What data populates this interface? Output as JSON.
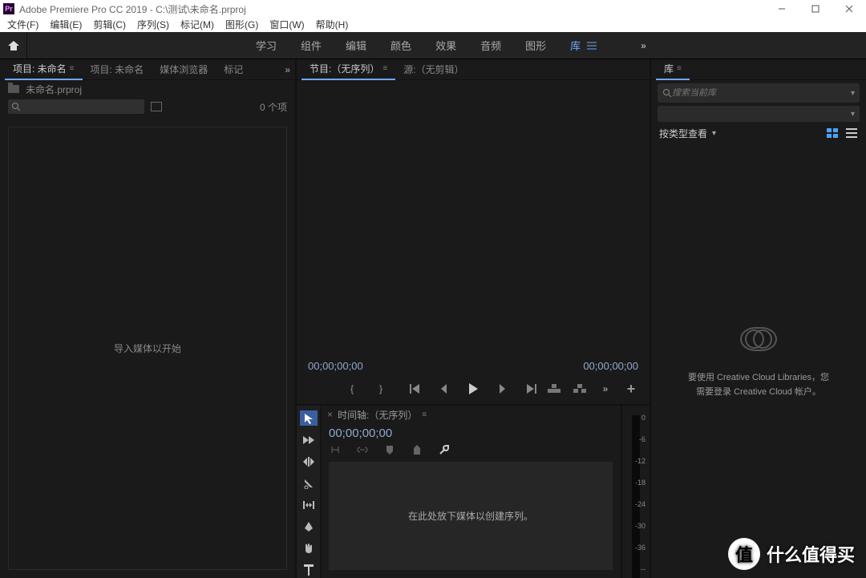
{
  "title_bar": {
    "logo_text": "Pr",
    "title": "Adobe Premiere Pro CC 2019 - C:\\测试\\未命名.prproj"
  },
  "menu": {
    "file": "文件(F)",
    "edit": "编辑(E)",
    "clip": "剪辑(C)",
    "sequence": "序列(S)",
    "marker": "标记(M)",
    "graphics": "图形(G)",
    "window": "窗口(W)",
    "help": "帮助(H)"
  },
  "workspaces": {
    "learn": "学习",
    "assembly": "组件",
    "edit": "编辑",
    "color": "颜色",
    "effects": "效果",
    "audio": "音频",
    "graphics": "图形",
    "libraries": "库",
    "overflow": "»"
  },
  "project_panel": {
    "tabs": {
      "project_active": "项目: 未命名",
      "project_dup": "项目: 未命名",
      "media_browser": "媒体浏览器",
      "markers": "标记"
    },
    "file_name": "未命名.prproj",
    "item_count": "0 个项",
    "drop_hint": "导入媒体以开始"
  },
  "program_panel": {
    "tab_program": "节目:（无序列）",
    "tab_source": "源:（无剪辑）",
    "current_tc": "00;00;00;00",
    "total_tc": "00;00;00;00"
  },
  "timeline_panel": {
    "tab_label": "时间轴:（无序列）",
    "tc": "00;00;00;00",
    "drop_hint": "在此处放下媒体以创建序列。"
  },
  "audio_meter": {
    "ticks": [
      "0",
      "-6",
      "-12",
      "-18",
      "-24",
      "-30",
      "-36",
      "--"
    ]
  },
  "libraries_panel": {
    "tab_label": "库",
    "search_placeholder": "搜索当前库",
    "view_label": "按类型查看",
    "msg_line1": "要使用 Creative Cloud Libraries，您",
    "msg_line2": "需要登录 Creative Cloud 帐户。"
  },
  "watermark": {
    "circle": "值",
    "text": "什么值得买"
  }
}
